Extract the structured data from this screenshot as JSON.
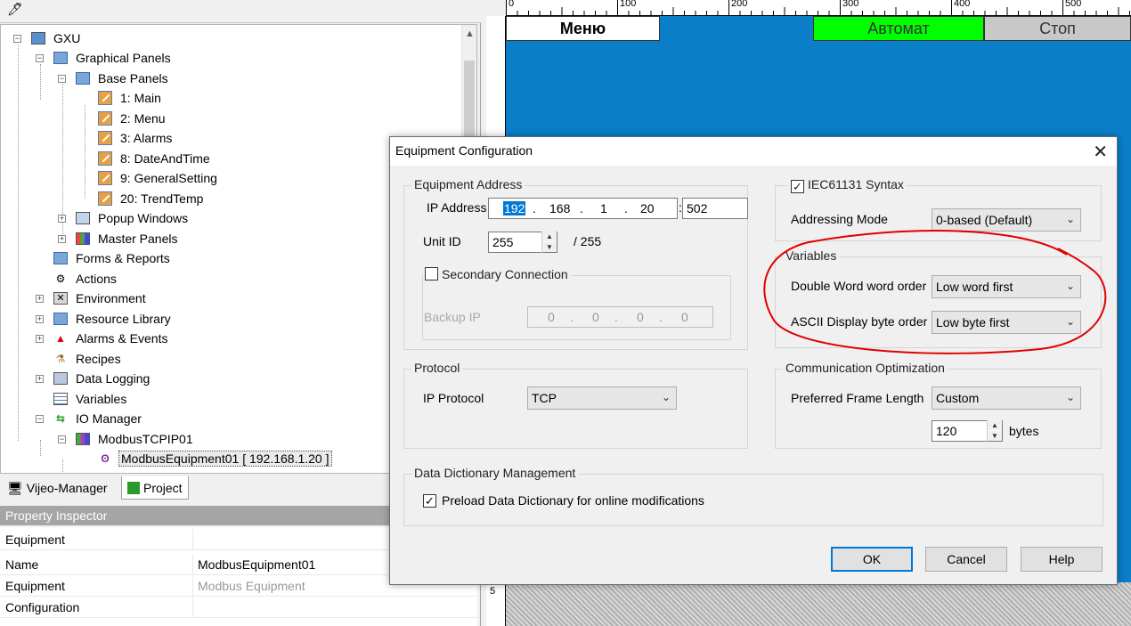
{
  "tree": {
    "root": "GXU",
    "nodes": [
      {
        "label": "Graphical Panels"
      },
      {
        "label": "Base Panels"
      },
      {
        "label": "1: Main"
      },
      {
        "label": "2: Menu"
      },
      {
        "label": "3: Alarms"
      },
      {
        "label": "8: DateAndTime"
      },
      {
        "label": "9: GeneralSetting"
      },
      {
        "label": "20: TrendTemp"
      },
      {
        "label": "Popup Windows"
      },
      {
        "label": "Master Panels"
      },
      {
        "label": "Forms & Reports"
      },
      {
        "label": "Actions"
      },
      {
        "label": "Environment"
      },
      {
        "label": "Resource Library"
      },
      {
        "label": "Alarms & Events"
      },
      {
        "label": "Recipes"
      },
      {
        "label": "Data Logging"
      },
      {
        "label": "Variables"
      },
      {
        "label": "IO Manager"
      },
      {
        "label": "ModbusTCPIP01"
      },
      {
        "label": "ModbusEquipment01 [ 192.168.1.20 ]"
      }
    ]
  },
  "tabs": {
    "vijeo": "Vijeo-Manager",
    "project": "Project"
  },
  "property_inspector": {
    "title": "Property Inspector",
    "section": "Equipment",
    "rows": [
      {
        "key": "Name",
        "value": "ModbusEquipment01"
      },
      {
        "key": "Equipment",
        "value": "Modbus Equipment"
      },
      {
        "key": "Configuration",
        "value": ""
      }
    ]
  },
  "ruler": {
    "top": [
      "0",
      "100",
      "200",
      "300",
      "400",
      "500"
    ],
    "left": "5"
  },
  "hmi": {
    "menu": "Меню",
    "auto": "Автомат",
    "stop": "Стоп",
    "menu_color": "#ffffff",
    "auto_color": "#00ff00",
    "stop_color": "#c8c8c8"
  },
  "dialog": {
    "title": "Equipment Configuration",
    "equipment_address": {
      "title": "Equipment Address",
      "ip_label": "IP Address",
      "ip": [
        "192",
        "168",
        "1",
        "20"
      ],
      "port_sep": ":",
      "port": "502",
      "unit_label": "Unit ID",
      "unit_value": "255",
      "unit_max": "/ 255",
      "secondary_label": "Secondary Connection",
      "backup_label": "Backup IP",
      "backup_ip": [
        "0",
        "0",
        "0",
        "0"
      ]
    },
    "iec": {
      "label": "IEC61131 Syntax",
      "checked": "✓",
      "addressing_label": "Addressing Mode",
      "addressing_value": "0-based (Default)"
    },
    "variables": {
      "title": "Variables",
      "dword_label": "Double Word word order",
      "dword_value": "Low word first",
      "ascii_label": "ASCII Display byte order",
      "ascii_value": "Low byte first"
    },
    "protocol": {
      "title": "Protocol",
      "ip_protocol_label": "IP Protocol",
      "ip_protocol_value": "TCP"
    },
    "comm": {
      "title": "Communication Optimization",
      "frame_label": "Preferred Frame Length",
      "frame_value": "Custom",
      "bytes_value": "120",
      "bytes_label": "bytes"
    },
    "dictionary": {
      "title": "Data Dictionary Management",
      "preload_label": "Preload Data Dictionary for online modifications",
      "checked": "✓"
    },
    "buttons": {
      "ok": "OK",
      "cancel": "Cancel",
      "help": "Help"
    },
    "annotation_color": "#e00000"
  }
}
